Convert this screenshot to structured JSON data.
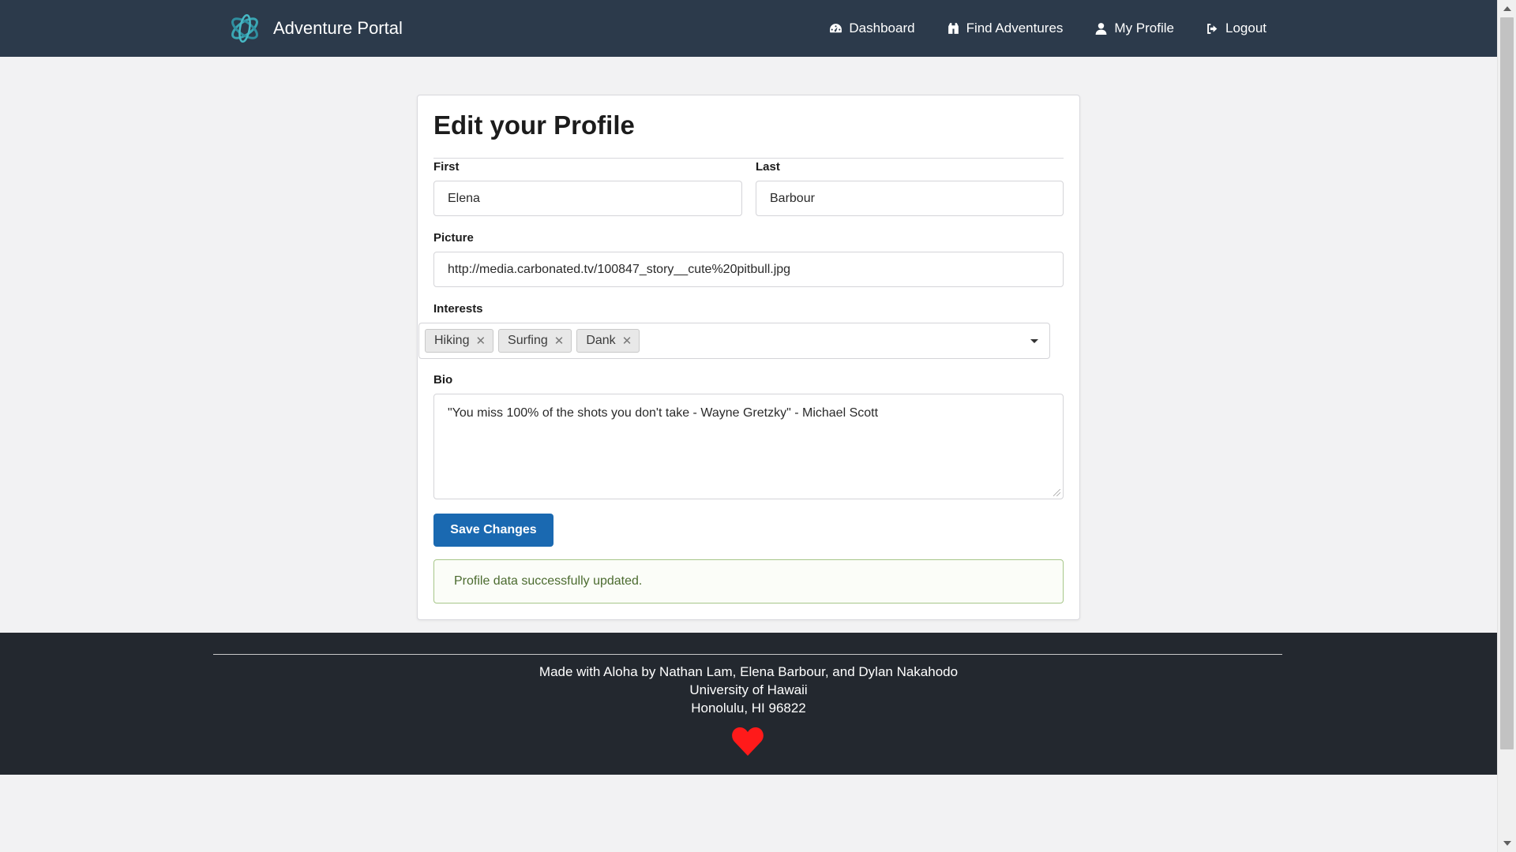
{
  "navbar": {
    "brand": "Adventure Portal",
    "items": [
      {
        "label": "Dashboard",
        "icon": "dashboard-icon"
      },
      {
        "label": "Find Adventures",
        "icon": "binoculars-icon"
      },
      {
        "label": "My Profile",
        "icon": "user-icon"
      },
      {
        "label": "Logout",
        "icon": "sign-out-icon"
      }
    ]
  },
  "form": {
    "title": "Edit your Profile",
    "first_label": "First",
    "first_value": "Elena",
    "last_label": "Last",
    "last_value": "Barbour",
    "picture_label": "Picture",
    "picture_value": "http://media.carbonated.tv/100847_story__cute%20pitbull.jpg",
    "interests_label": "Interests",
    "interests": [
      "Hiking",
      "Surfing",
      "Dank"
    ],
    "bio_label": "Bio",
    "bio_value": "\"You miss 100% of the shots you don't take - Wayne Gretzky\" - Michael Scott",
    "save_label": "Save Changes",
    "success_message": "Profile data successfully updated."
  },
  "footer": {
    "line1": "Made with Aloha by Nathan Lam, Elena Barbour, and Dylan Nakahodo",
    "line2": "University of Hawaii",
    "line3": "Honolulu, HI 96822"
  },
  "colors": {
    "navbar_bg": "#2c3a4b",
    "footer_bg": "#23282f",
    "primary_button": "#1a69b1",
    "success_border": "#a7c78a",
    "heart": "#ff1a1a"
  }
}
